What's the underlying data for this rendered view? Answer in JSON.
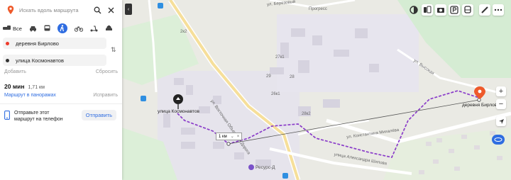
{
  "search": {
    "placeholder": "Искать вдоль маршрута"
  },
  "modes": {
    "all_label": "Все"
  },
  "route": {
    "from": "деревня Бирлово",
    "to": "улица Космонавтов",
    "add_label": "Добавить",
    "reset_label": "Сбросить",
    "time": "20 мин",
    "distance": "1,71 км",
    "panorama_label": "Маршрут в панорамах",
    "edit_label": "Исправить",
    "send_text": "Отправьте этот маршрут на телефон",
    "send_button": "Отправить"
  },
  "map": {
    "start_label": "улица Космонавтов",
    "end_label": "деревня Бирлово",
    "scale_label": "1 км",
    "mall_label": "Ресурс-Д",
    "streets": {
      "vostochnaya": "ул. Восточная Объездная Дорога",
      "konstantina": "ул. Константина Михалёва",
      "aleksandra": "улица Александра Шилова",
      "berezovy": "ул. Березовый",
      "progress": "Прогресс",
      "vysokaya": "ул. Высокая"
    },
    "building_numbers": [
      "2к2",
      "27к1",
      "29",
      "26к1",
      "28",
      "28к2"
    ]
  },
  "colors": {
    "accent": "#2f6de1",
    "route": "#8a3cc9",
    "marker": "#ee5a2b"
  }
}
